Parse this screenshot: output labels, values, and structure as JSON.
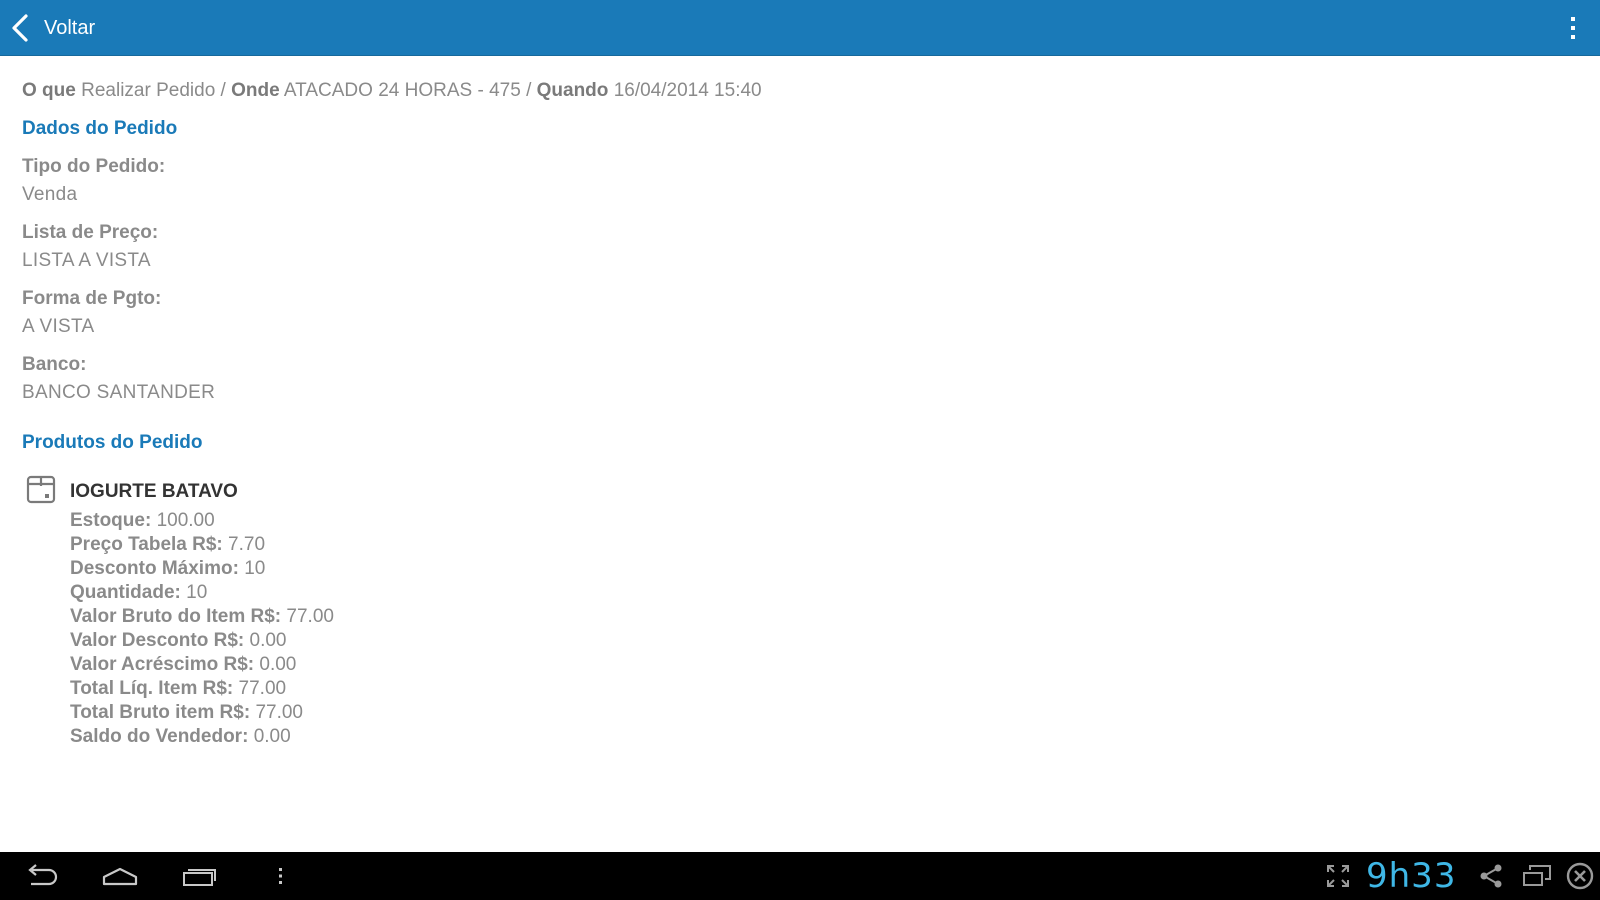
{
  "action_bar": {
    "back_label": "Voltar",
    "color": "#1a7ab8"
  },
  "summary": {
    "what_label": "O que",
    "what_value": "Realizar Pedido",
    "where_label": "Onde",
    "where_value": "ATACADO 24 HORAS - 475",
    "when_label": "Quando",
    "when_value": "16/04/2014 15:40",
    "separator": "/"
  },
  "order_data": {
    "title": "Dados do Pedido",
    "fields": [
      {
        "label": "Tipo do Pedido:",
        "value": "Venda"
      },
      {
        "label": "Lista de Preço:",
        "value": "LISTA A VISTA"
      },
      {
        "label": "Forma de Pgto:",
        "value": "A VISTA"
      },
      {
        "label": "Banco:",
        "value": "BANCO SANTANDER"
      }
    ]
  },
  "order_products": {
    "title": "Produtos do Pedido",
    "products": [
      {
        "name": "IOGURTE BATAVO",
        "icon": "box-icon",
        "details": [
          {
            "label": "Estoque:",
            "value": "100.00"
          },
          {
            "label": "Preço Tabela R$:",
            "value": "7.70"
          },
          {
            "label": "Desconto Máximo:",
            "value": "10"
          },
          {
            "label": "Quantidade:",
            "value": "10"
          },
          {
            "label": "Valor Bruto do Item R$:",
            "value": "77.00"
          },
          {
            "label": "Valor Desconto R$:",
            "value": "0.00"
          },
          {
            "label": "Valor Acréscimo R$:",
            "value": "0.00"
          },
          {
            "label": "Total Líq. Item R$:",
            "value": "77.00"
          },
          {
            "label": "Total Bruto item R$:",
            "value": "77.00"
          },
          {
            "label": "Saldo do Vendedor:",
            "value": "0.00"
          }
        ]
      }
    ]
  },
  "nav_bar": {
    "clock": "9h33",
    "clock_color": "#3fb7e6"
  }
}
